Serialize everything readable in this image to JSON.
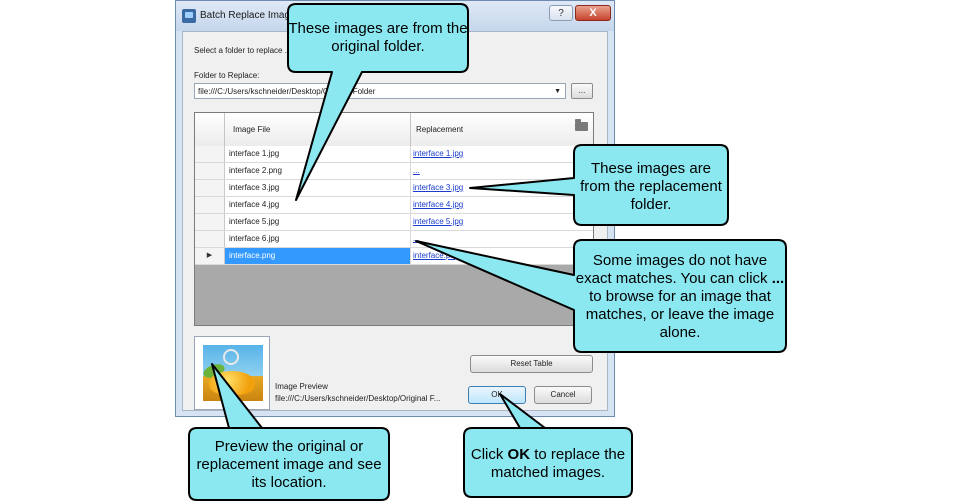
{
  "dialog": {
    "title": "Batch Replace Images",
    "help_label": "?",
    "close_label": "X",
    "instructions": "Select a folder to replace ... links in the grid below.",
    "folder_label": "Folder to Replace:",
    "folder_path": "file:///C:/Users/kschneider/Desktop/Original Folder",
    "browse_label": "...",
    "grid": {
      "columns": [
        "Image File",
        "Replacement"
      ],
      "rows": [
        {
          "file": "interface 1.jpg",
          "replacement": "interface 1.jpg"
        },
        {
          "file": "interface 2.png",
          "replacement": "..."
        },
        {
          "file": "interface 3.jpg",
          "replacement": "interface 3.jpg"
        },
        {
          "file": "interface 4.jpg",
          "replacement": "interface 4.jpg"
        },
        {
          "file": "interface 5.jpg",
          "replacement": "interface 5.jpg"
        },
        {
          "file": "interface 6.jpg",
          "replacement": "..."
        },
        {
          "file": "interface.png",
          "replacement": "interface.png",
          "selected": true,
          "marker": "▶"
        }
      ]
    },
    "image_preview_label": "Image Preview",
    "image_preview_path": "file:///C:/Users/kschneider/Desktop/Original F...",
    "reset_label": "Reset Table",
    "ok_label": "OK",
    "cancel_label": "Cancel"
  },
  "callouts": {
    "original": "These images are from the original folder.",
    "replacement": "These images are from the replacement folder.",
    "no_match_pre": "Some images do not have exact matches. You can click",
    "no_match_bold": "...",
    "no_match_post": "to browse for an image that matches, or leave the image alone.",
    "preview": "Preview the original or replacement image and see its location.",
    "ok_pre": "Click",
    "ok_bold": "OK",
    "ok_post": "to replace the matched images."
  },
  "colors": {
    "callout_fill": "#8ce8f0",
    "callout_stroke": "#000000",
    "selection": "#3399ff",
    "link": "#1a3ccc"
  }
}
